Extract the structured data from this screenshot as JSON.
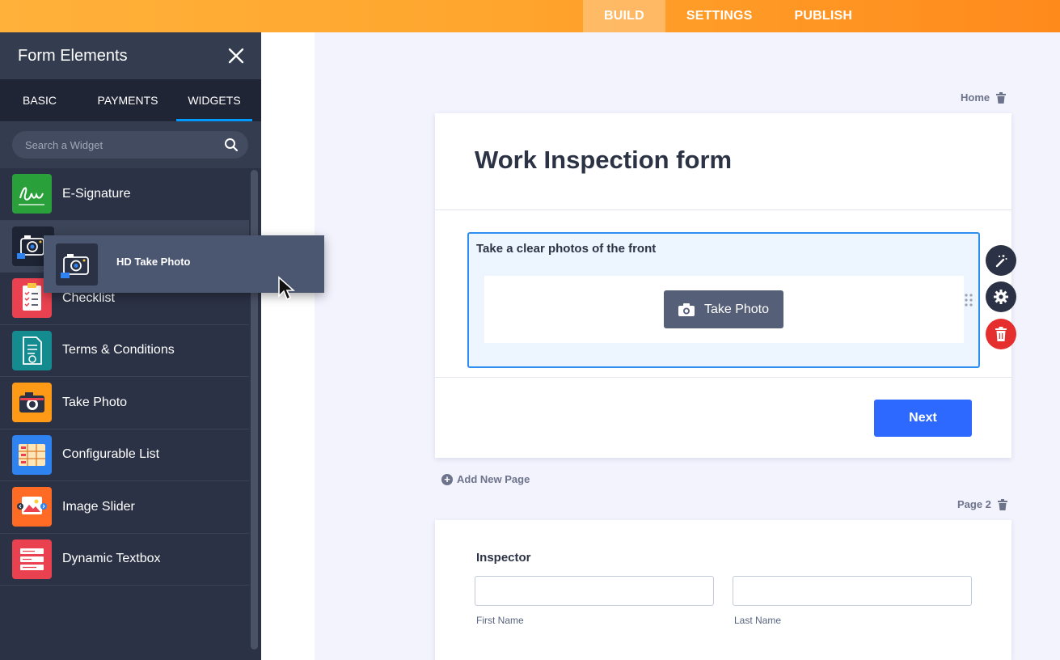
{
  "topnav": {
    "tabs": [
      {
        "label": "BUILD",
        "active": true
      },
      {
        "label": "SETTINGS",
        "active": false
      },
      {
        "label": "PUBLISH",
        "active": false
      }
    ]
  },
  "sidebar": {
    "title": "Form Elements",
    "tabs": [
      "BASIC",
      "PAYMENTS",
      "WIDGETS"
    ],
    "active_tab": "WIDGETS",
    "search_placeholder": "Search a Widget",
    "items": [
      {
        "label": "E-Signature",
        "icon": "signature-icon",
        "color": "#2aa03a"
      },
      {
        "label": "HD Take Photo",
        "icon": "hd-camera-icon",
        "color": "#2b3245"
      },
      {
        "label": "Checklist",
        "icon": "checklist-icon",
        "color": "#e9414f"
      },
      {
        "label": "Terms & Conditions",
        "icon": "document-check-icon",
        "color": "#138b8f"
      },
      {
        "label": "Take Photo",
        "icon": "camera-icon",
        "color": "#ff9a17"
      },
      {
        "label": "Configurable List",
        "icon": "list-grid-icon",
        "color": "#2f83f0"
      },
      {
        "label": "Image Slider",
        "icon": "image-slider-icon",
        "color": "#ff6b24"
      },
      {
        "label": "Dynamic Textbox",
        "icon": "textbox-icon",
        "color": "#e9414f"
      }
    ],
    "dragging": {
      "label": "HD Take Photo"
    }
  },
  "page1": {
    "label": "Home",
    "form_title": "Work Inspection form",
    "field_label": "Take a clear photos of the front",
    "take_photo_label": "Take Photo",
    "next_label": "Next"
  },
  "add_page_label": "Add New Page",
  "page2": {
    "label": "Page 2",
    "field_label": "Inspector",
    "first_name_label": "First Name",
    "last_name_label": "Last Name"
  },
  "colors": {
    "accent_orange": "#ff9a2a",
    "sidebar_bg": "#2b3245",
    "primary_blue": "#2e69ff",
    "selection_border": "#2f8ff0",
    "delete_red": "#e52e2e"
  }
}
